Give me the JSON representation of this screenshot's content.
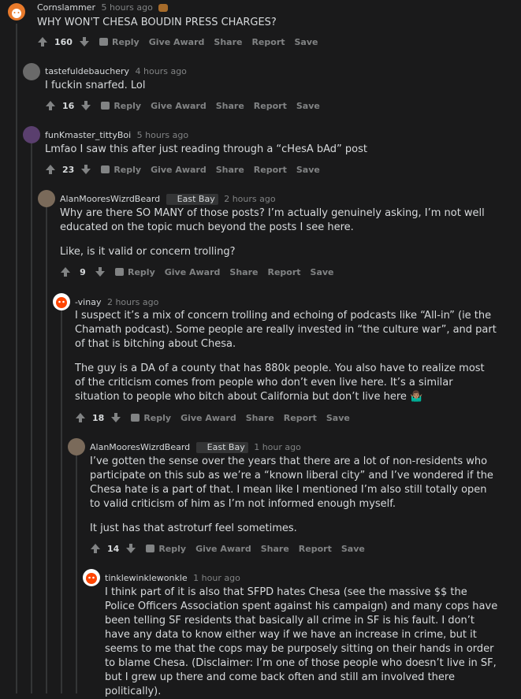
{
  "comments": [
    {
      "user": "Cornslammer",
      "time": "5 hours ago",
      "flair": "",
      "paragraphs": [
        "WHY WON'T CHESA BOUDIN PRESS CHARGES?"
      ],
      "score": "160",
      "actions": [
        "Reply",
        "Give Award",
        "Share",
        "Report",
        "Save"
      ]
    },
    {
      "user": "tastefuldebauchery",
      "time": "4 hours ago",
      "flair": "",
      "paragraphs": [
        "I fuckin snarfed. Lol"
      ],
      "score": "16",
      "actions": [
        "Reply",
        "Give Award",
        "Share",
        "Report",
        "Save"
      ]
    },
    {
      "user": "funKmaster_tittyBoi",
      "time": "5 hours ago",
      "flair": "",
      "paragraphs": [
        "Lmfao I saw this after just reading through a “cHesA bAd” post"
      ],
      "score": "23",
      "actions": [
        "Reply",
        "Give Award",
        "Share",
        "Report",
        "Save"
      ]
    },
    {
      "user": "AlanMooresWizrdBeard",
      "time": "2 hours ago",
      "flair": "East Bay",
      "paragraphs": [
        "Why are there SO MANY of those posts? I’m actually genuinely asking, I’m not well educated on the topic much beyond the posts I see here.",
        "Like, is it valid or concern trolling?"
      ],
      "score": "9",
      "actions": [
        "Reply",
        "Give Award",
        "Share",
        "Report",
        "Save"
      ]
    },
    {
      "user": "-vinay",
      "time": "2 hours ago",
      "flair": "",
      "paragraphs": [
        "I suspect it’s a mix of concern trolling and echoing of podcasts like “All-in” (ie the Chamath podcast). Some people are really invested in “the culture war”, and part of that is bitching about Chesa.",
        "The guy is a DA of a county that has 880k people. You also have to realize most of the criticism comes from people who don’t even live here. It’s a similar situation to people who bitch about California but don’t live here 🤷🏽‍♂️"
      ],
      "score": "18",
      "actions": [
        "Reply",
        "Give Award",
        "Share",
        "Report",
        "Save"
      ]
    },
    {
      "user": "AlanMooresWizrdBeard",
      "time": "1 hour ago",
      "flair": "East Bay",
      "paragraphs": [
        "I’ve gotten the sense over the years that there are a lot of non-residents who participate on this sub as we’re a “known liberal city” and I’ve wondered if the Chesa hate is a part of that. I mean like I mentioned I’m also still totally open to valid criticism of him as I’m not informed enough myself.",
        "It just has that astroturf feel sometimes."
      ],
      "score": "14",
      "actions": [
        "Reply",
        "Give Award",
        "Share",
        "Report",
        "Save"
      ]
    },
    {
      "user": "tinklewinklewonkle",
      "time": "1 hour ago",
      "flair": "",
      "paragraphs": [
        "I think part of it is also that SFPD hates Chesa (see the massive $$ the Police Officers Association spent against his campaign) and many cops have been telling SF residents that basically all crime in SF is his fault. I don’t have any data to know either way if we have an increase in crime, but it seems to me that the cops may be purposely sitting on their hands in order to blame Chesa. (Disclaimer: I’m one of those people who doesn’t live in SF, but I grew up there and come back often and still am involved there politically)."
      ],
      "score": "",
      "actions": []
    }
  ],
  "colors": {
    "background": "#1a1a1b",
    "text": "#d7dadc",
    "muted": "#818384",
    "thread_line": "#343536",
    "snoo_accent": "#ff4500"
  }
}
